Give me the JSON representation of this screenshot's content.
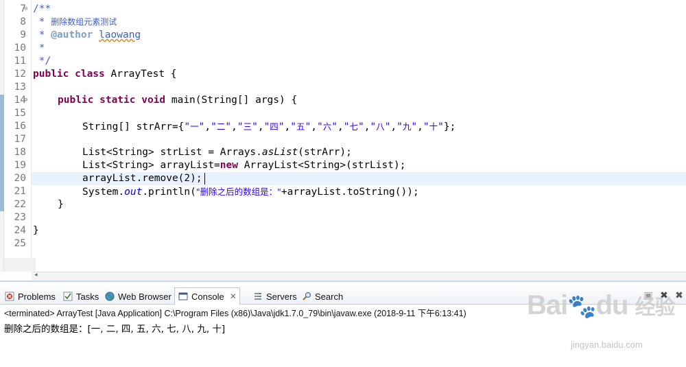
{
  "editor": {
    "line_numbers": [
      "7",
      "8",
      "9",
      "10",
      "11",
      "12",
      "13",
      "14",
      "15",
      "16",
      "17",
      "18",
      "19",
      "20",
      "21",
      "22",
      "23",
      "24",
      "25"
    ],
    "code": {
      "l7": "/**",
      "l8_prefix": " * ",
      "l8_cjk": "删除数组元素测试",
      "l9_star": " * ",
      "l9_tag": "@author",
      "l9_name": "laowang",
      "l10": " *",
      "l11": " */",
      "l12_kw": "public class",
      "l12_rest": " ArrayTest {",
      "l14_kw": "public static void",
      "l14_rest": " main(String[] args) {",
      "l16_pre": "String[] strArr={",
      "l16_items": [
        "一",
        "二",
        "三",
        "四",
        "五",
        "六",
        "七",
        "八",
        "九",
        "十"
      ],
      "l16_post": "};",
      "l18_pre": "List<String> strList = Arrays.",
      "l18_ital": "asList",
      "l18_post": "(strArr);",
      "l19_pre": "List<String> arrayList=",
      "l19_kw": "new",
      "l19_post": " ArrayList<String>(strList);",
      "l20": "arrayList.remove(2);",
      "l21_pre": "System.",
      "l21_fld": "out",
      "l21_mid": ".println(",
      "l21_str": "\"删除之后的数组是：\"",
      "l21_post": "+arrayList.toString());",
      "l22": "}",
      "l24": "}"
    }
  },
  "panel": {
    "tabs": [
      {
        "label": "Problems",
        "icon": "problems-icon"
      },
      {
        "label": "Tasks",
        "icon": "tasks-icon"
      },
      {
        "label": "Web Browser",
        "icon": "web-browser-icon"
      },
      {
        "label": "Console",
        "icon": "console-icon"
      },
      {
        "label": "Servers",
        "icon": "servers-icon"
      },
      {
        "label": "Search",
        "icon": "search-icon"
      }
    ],
    "active_tab": "Console",
    "status": "<terminated> ArrayTest [Java Application] C:\\Program Files (x86)\\Java\\jdk1.7.0_79\\bin\\javaw.exe (2018-9-11 下午6:13:41)",
    "output": "删除之后的数组是：[一, 二, 四, 五, 六, 七, 八, 九, 十]"
  },
  "watermark": {
    "logo": "Bai du 经验",
    "url": "jingyan.baidu.com"
  },
  "colors": {
    "keyword": "#7f0055",
    "comment": "#3f5fbf",
    "string": "#2a00ff",
    "current_line": "#e8f2fe"
  }
}
